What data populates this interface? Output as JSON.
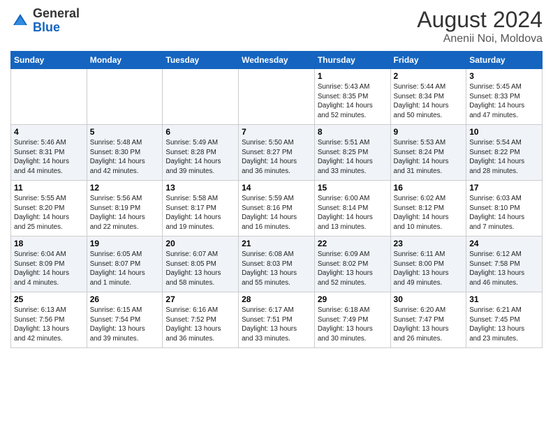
{
  "header": {
    "logo_general": "General",
    "logo_blue": "Blue",
    "month_title": "August 2024",
    "location": "Anenii Noi, Moldova"
  },
  "days_of_week": [
    "Sunday",
    "Monday",
    "Tuesday",
    "Wednesday",
    "Thursday",
    "Friday",
    "Saturday"
  ],
  "weeks": [
    [
      {
        "day": "",
        "info": ""
      },
      {
        "day": "",
        "info": ""
      },
      {
        "day": "",
        "info": ""
      },
      {
        "day": "",
        "info": ""
      },
      {
        "day": "1",
        "info": "Sunrise: 5:43 AM\nSunset: 8:35 PM\nDaylight: 14 hours\nand 52 minutes."
      },
      {
        "day": "2",
        "info": "Sunrise: 5:44 AM\nSunset: 8:34 PM\nDaylight: 14 hours\nand 50 minutes."
      },
      {
        "day": "3",
        "info": "Sunrise: 5:45 AM\nSunset: 8:33 PM\nDaylight: 14 hours\nand 47 minutes."
      }
    ],
    [
      {
        "day": "4",
        "info": "Sunrise: 5:46 AM\nSunset: 8:31 PM\nDaylight: 14 hours\nand 44 minutes."
      },
      {
        "day": "5",
        "info": "Sunrise: 5:48 AM\nSunset: 8:30 PM\nDaylight: 14 hours\nand 42 minutes."
      },
      {
        "day": "6",
        "info": "Sunrise: 5:49 AM\nSunset: 8:28 PM\nDaylight: 14 hours\nand 39 minutes."
      },
      {
        "day": "7",
        "info": "Sunrise: 5:50 AM\nSunset: 8:27 PM\nDaylight: 14 hours\nand 36 minutes."
      },
      {
        "day": "8",
        "info": "Sunrise: 5:51 AM\nSunset: 8:25 PM\nDaylight: 14 hours\nand 33 minutes."
      },
      {
        "day": "9",
        "info": "Sunrise: 5:53 AM\nSunset: 8:24 PM\nDaylight: 14 hours\nand 31 minutes."
      },
      {
        "day": "10",
        "info": "Sunrise: 5:54 AM\nSunset: 8:22 PM\nDaylight: 14 hours\nand 28 minutes."
      }
    ],
    [
      {
        "day": "11",
        "info": "Sunrise: 5:55 AM\nSunset: 8:20 PM\nDaylight: 14 hours\nand 25 minutes."
      },
      {
        "day": "12",
        "info": "Sunrise: 5:56 AM\nSunset: 8:19 PM\nDaylight: 14 hours\nand 22 minutes."
      },
      {
        "day": "13",
        "info": "Sunrise: 5:58 AM\nSunset: 8:17 PM\nDaylight: 14 hours\nand 19 minutes."
      },
      {
        "day": "14",
        "info": "Sunrise: 5:59 AM\nSunset: 8:16 PM\nDaylight: 14 hours\nand 16 minutes."
      },
      {
        "day": "15",
        "info": "Sunrise: 6:00 AM\nSunset: 8:14 PM\nDaylight: 14 hours\nand 13 minutes."
      },
      {
        "day": "16",
        "info": "Sunrise: 6:02 AM\nSunset: 8:12 PM\nDaylight: 14 hours\nand 10 minutes."
      },
      {
        "day": "17",
        "info": "Sunrise: 6:03 AM\nSunset: 8:10 PM\nDaylight: 14 hours\nand 7 minutes."
      }
    ],
    [
      {
        "day": "18",
        "info": "Sunrise: 6:04 AM\nSunset: 8:09 PM\nDaylight: 14 hours\nand 4 minutes."
      },
      {
        "day": "19",
        "info": "Sunrise: 6:05 AM\nSunset: 8:07 PM\nDaylight: 14 hours\nand 1 minute."
      },
      {
        "day": "20",
        "info": "Sunrise: 6:07 AM\nSunset: 8:05 PM\nDaylight: 13 hours\nand 58 minutes."
      },
      {
        "day": "21",
        "info": "Sunrise: 6:08 AM\nSunset: 8:03 PM\nDaylight: 13 hours\nand 55 minutes."
      },
      {
        "day": "22",
        "info": "Sunrise: 6:09 AM\nSunset: 8:02 PM\nDaylight: 13 hours\nand 52 minutes."
      },
      {
        "day": "23",
        "info": "Sunrise: 6:11 AM\nSunset: 8:00 PM\nDaylight: 13 hours\nand 49 minutes."
      },
      {
        "day": "24",
        "info": "Sunrise: 6:12 AM\nSunset: 7:58 PM\nDaylight: 13 hours\nand 46 minutes."
      }
    ],
    [
      {
        "day": "25",
        "info": "Sunrise: 6:13 AM\nSunset: 7:56 PM\nDaylight: 13 hours\nand 42 minutes."
      },
      {
        "day": "26",
        "info": "Sunrise: 6:15 AM\nSunset: 7:54 PM\nDaylight: 13 hours\nand 39 minutes."
      },
      {
        "day": "27",
        "info": "Sunrise: 6:16 AM\nSunset: 7:52 PM\nDaylight: 13 hours\nand 36 minutes."
      },
      {
        "day": "28",
        "info": "Sunrise: 6:17 AM\nSunset: 7:51 PM\nDaylight: 13 hours\nand 33 minutes."
      },
      {
        "day": "29",
        "info": "Sunrise: 6:18 AM\nSunset: 7:49 PM\nDaylight: 13 hours\nand 30 minutes."
      },
      {
        "day": "30",
        "info": "Sunrise: 6:20 AM\nSunset: 7:47 PM\nDaylight: 13 hours\nand 26 minutes."
      },
      {
        "day": "31",
        "info": "Sunrise: 6:21 AM\nSunset: 7:45 PM\nDaylight: 13 hours\nand 23 minutes."
      }
    ]
  ]
}
